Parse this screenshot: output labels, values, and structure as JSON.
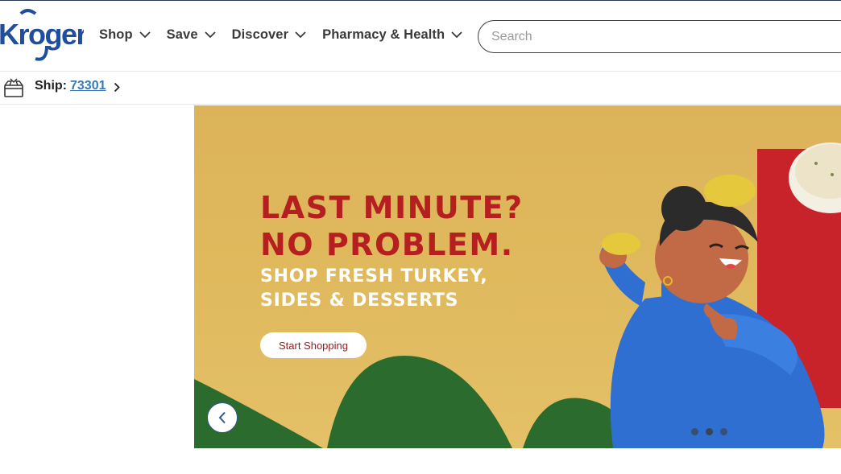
{
  "brand": {
    "name": "Kroger",
    "color": "#1f4e9c"
  },
  "nav": {
    "items": [
      {
        "label": "Shop"
      },
      {
        "label": "Save"
      },
      {
        "label": "Discover"
      },
      {
        "label": "Pharmacy & Health"
      }
    ],
    "chevron_icon": "chevron-down-icon"
  },
  "search": {
    "placeholder": "Search",
    "value": ""
  },
  "ship": {
    "label": "Ship:",
    "zip": "73301",
    "icon": "package-box-icon"
  },
  "hero": {
    "headline_line1": "LAST MINUTE?",
    "headline_line2": "NO PROBLEM.",
    "subline_line1": "SHOP FRESH TURKEY,",
    "subline_line2": "SIDES & DESSERTS",
    "cta_label": "Start Shopping",
    "carousel": {
      "slide_count": 3,
      "active_slide": 2
    },
    "colors": {
      "background": "#dcb35a",
      "headline": "#b51f1f",
      "accent_red": "#c8232b",
      "hills": "#2c6b2e"
    }
  }
}
